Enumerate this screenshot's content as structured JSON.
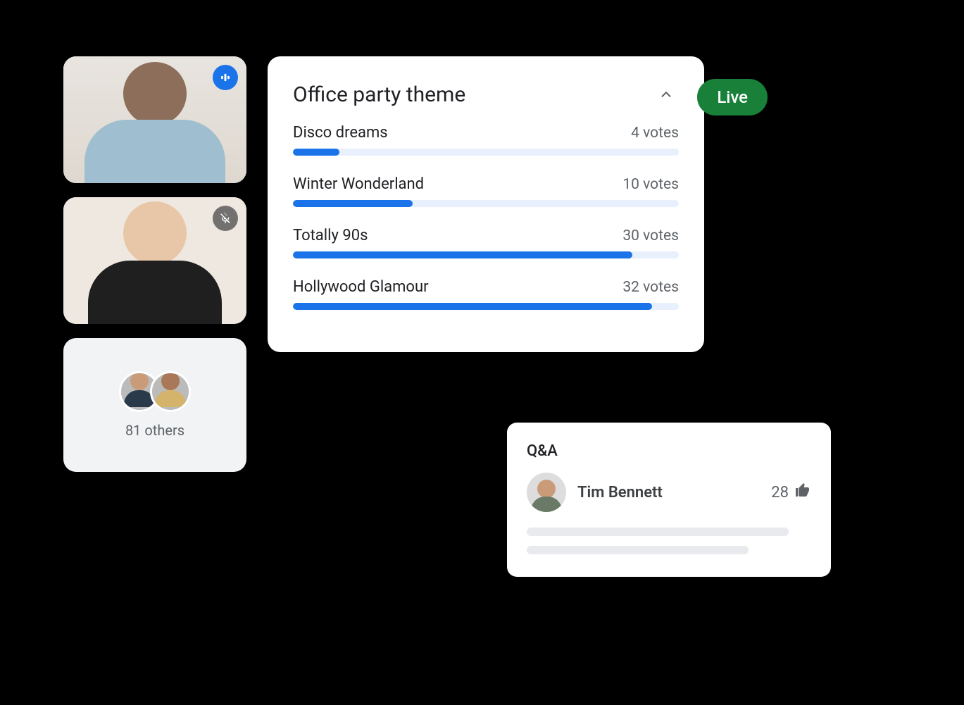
{
  "colors": {
    "blue": "#1a73e8",
    "green": "#188038",
    "accent_ring": "#8ab4f8"
  },
  "tiles": {
    "speaker_icon": "speaking-bars-icon",
    "muted_icon": "mic-off-icon"
  },
  "others": {
    "count_label": "81 others"
  },
  "live_label": "Live",
  "poll": {
    "title": "Office party theme",
    "collapse_icon": "chevron-up-icon",
    "options": [
      {
        "label": "Disco dreams",
        "votes_label": "4 votes",
        "percent": 12
      },
      {
        "label": "Winter Wonderland",
        "votes_label": "10 votes",
        "percent": 31
      },
      {
        "label": "Totally 90s",
        "votes_label": "30 votes",
        "percent": 88
      },
      {
        "label": "Hollywood Glamour",
        "votes_label": "32 votes",
        "percent": 93
      }
    ]
  },
  "chart_data": {
    "type": "bar",
    "title": "Office party theme",
    "categories": [
      "Disco dreams",
      "Winter Wonderland",
      "Totally 90s",
      "Hollywood Glamour"
    ],
    "values": [
      4,
      10,
      30,
      32
    ],
    "xlabel": "",
    "ylabel": "votes"
  },
  "qa": {
    "title": "Q&A",
    "entry": {
      "name": "Tim Bennett",
      "upvotes": "28",
      "upvote_icon": "thumb-up-icon"
    }
  }
}
